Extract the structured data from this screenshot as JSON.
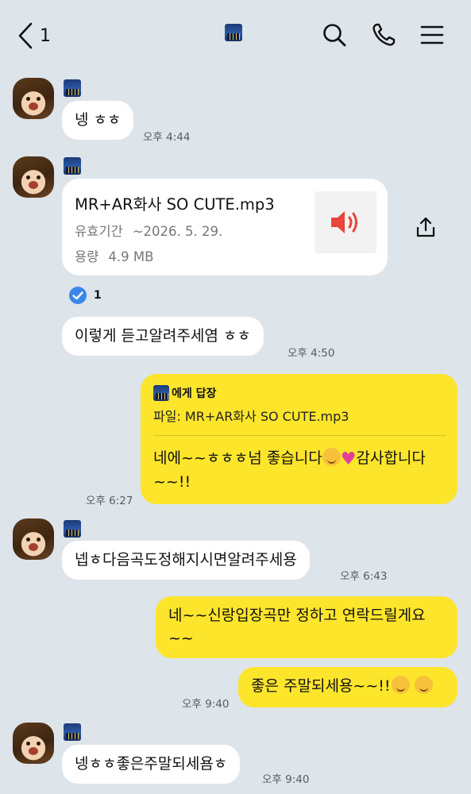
{
  "header": {
    "back_count": "1"
  },
  "messages": {
    "m1": {
      "text": "넹 ㅎㅎ",
      "time": "오후 4:44"
    },
    "file": {
      "name": "MR+AR화사 SO CUTE.mp3",
      "expiry_label": "유효기간",
      "expiry_value": "~2026. 5. 29.",
      "size_label": "용량",
      "size_value": "4.9 MB",
      "read_count": "1"
    },
    "m2": {
      "text": "이렇게 듣고알려주세염 ㅎㅎ",
      "time": "오후 4:50"
    },
    "reply": {
      "head": "에게 답장",
      "quote": "파일: MR+AR화사 SO CUTE.mp3",
      "text_part1": "네에~~ㅎㅎㅎ넘 좋습니다",
      "text_part2": "감사합니다~~!!",
      "time": "오후 6:27"
    },
    "m3": {
      "text": "넵ㅎ다음곡도정해지시면알려주세용",
      "time": "오후 6:43"
    },
    "m4": {
      "text": "네~~신랑입장곡만 정하고 연락드릴게요~~"
    },
    "m5": {
      "text": "좋은 주말되세용~~!!",
      "time": "오후 9:40"
    },
    "m6": {
      "text": "넹ㅎㅎ좋은주말되세욤ㅎ",
      "time": "오후 9:40"
    }
  },
  "icons": {
    "back": "chevron-left-icon",
    "search": "search-icon",
    "call": "phone-icon",
    "menu": "menu-icon",
    "share": "share-icon",
    "audio": "speaker-icon",
    "read": "check-circle-icon"
  },
  "colors": {
    "background": "#dde4ea",
    "outgoing_bubble": "#fde52c",
    "incoming_bubble": "#ffffff",
    "audio_icon": "#e8453c",
    "read_check": "#3a86e8"
  }
}
